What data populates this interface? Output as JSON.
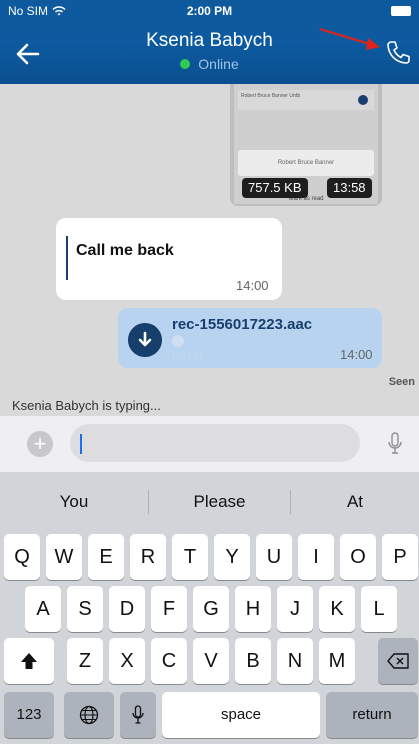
{
  "status_bar": {
    "carrier": "No SIM",
    "time": "2:00 PM"
  },
  "header": {
    "contact_name": "Ksenia Babych",
    "presence": "Online",
    "presence_color": "#2fcc52"
  },
  "icons": {
    "back": "back-arrow-icon",
    "call": "phone-call-icon",
    "plus": "plus-icon",
    "mic": "microphone-icon",
    "download": "download-icon"
  },
  "messages": {
    "media": {
      "file_size": "757.5 KB",
      "time": "13:58",
      "preview_row": "Robert Bruce Banner Urdb",
      "preview_card": "Robert Bruce Banner",
      "preview_footer": "Mark as read"
    },
    "text": {
      "body": "Call me back",
      "time": "14:00"
    },
    "voice": {
      "file_name": "rec-1556017223.aac",
      "duration": "00:00",
      "time": "14:00"
    }
  },
  "seen_label": "Seen",
  "typing_indicator": "Ksenia Babych is typing...",
  "composer": {
    "value": ""
  },
  "keyboard": {
    "suggestions": [
      "You",
      "Please",
      "At"
    ],
    "row1": [
      "Q",
      "W",
      "E",
      "R",
      "T",
      "Y",
      "U",
      "I",
      "O",
      "P"
    ],
    "row2": [
      "A",
      "S",
      "D",
      "F",
      "G",
      "H",
      "J",
      "K",
      "L"
    ],
    "row3": [
      "Z",
      "X",
      "C",
      "V",
      "B",
      "N",
      "M"
    ],
    "numbers_key": "123",
    "space_key": "space",
    "return_key": "return"
  }
}
